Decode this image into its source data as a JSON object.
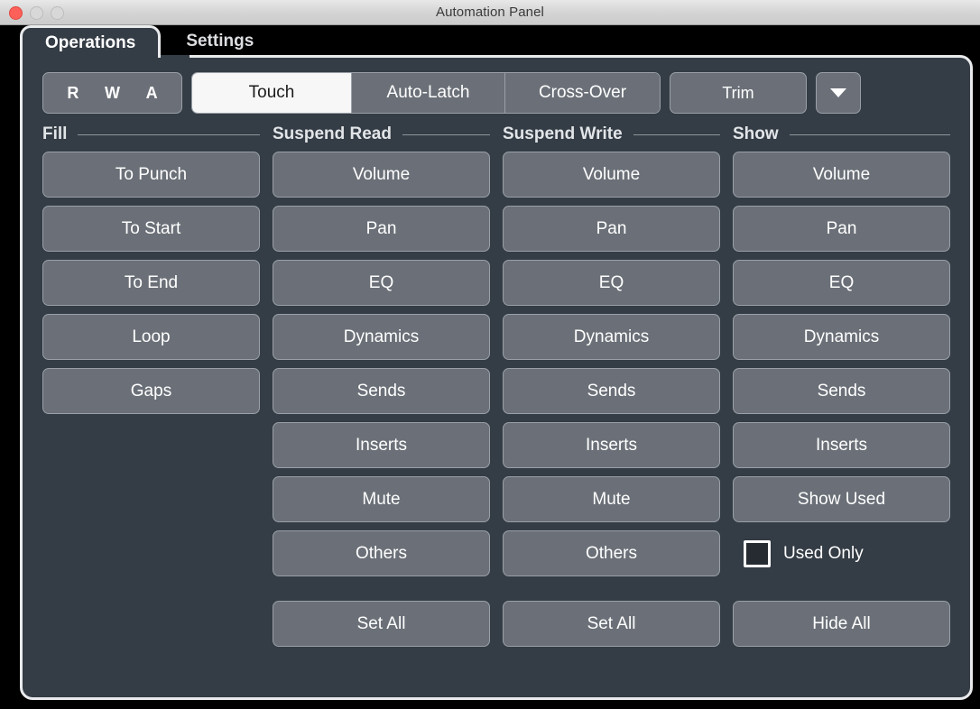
{
  "window": {
    "title": "Automation Panel",
    "traffic_lights": [
      {
        "name": "close",
        "color": "#fc6058"
      },
      {
        "name": "minimize",
        "color": "#d8d8d8"
      },
      {
        "name": "zoom",
        "color": "#d8d8d8"
      }
    ]
  },
  "tabs": [
    {
      "label": "Operations",
      "active": true
    },
    {
      "label": "Settings",
      "active": false
    }
  ],
  "toolbar": {
    "rwa": [
      "R",
      "W",
      "A"
    ],
    "modes": [
      {
        "label": "Touch",
        "selected": true
      },
      {
        "label": "Auto-Latch",
        "selected": false
      },
      {
        "label": "Cross-Over",
        "selected": false
      }
    ],
    "trim_label": "Trim",
    "dropdown_icon": "chevron-down-icon"
  },
  "columns": [
    {
      "header": "Fill",
      "buttons": [
        "To Punch",
        "To Start",
        "To End",
        "Loop",
        "Gaps"
      ]
    },
    {
      "header": "Suspend Read",
      "buttons": [
        "Volume",
        "Pan",
        "EQ",
        "Dynamics",
        "Sends",
        "Inserts",
        "Mute",
        "Others"
      ],
      "footer": "Set All"
    },
    {
      "header": "Suspend Write",
      "buttons": [
        "Volume",
        "Pan",
        "EQ",
        "Dynamics",
        "Sends",
        "Inserts",
        "Mute",
        "Others"
      ],
      "footer": "Set All"
    },
    {
      "header": "Show",
      "buttons": [
        "Volume",
        "Pan",
        "EQ",
        "Dynamics",
        "Sends",
        "Inserts",
        "Show Used"
      ],
      "checkbox": {
        "label": "Used Only",
        "checked": false
      },
      "footer": "Hide All"
    }
  ],
  "colors": {
    "panel_bg": "#343c45",
    "button_fill": "#6b7078",
    "button_border": "#9aa0a7",
    "selected_bg": "#f7f7f7",
    "selected_text": "#1c1c1c",
    "text": "#ffffff",
    "window_chrome": "#000000",
    "panel_border": "#e9eaec"
  }
}
